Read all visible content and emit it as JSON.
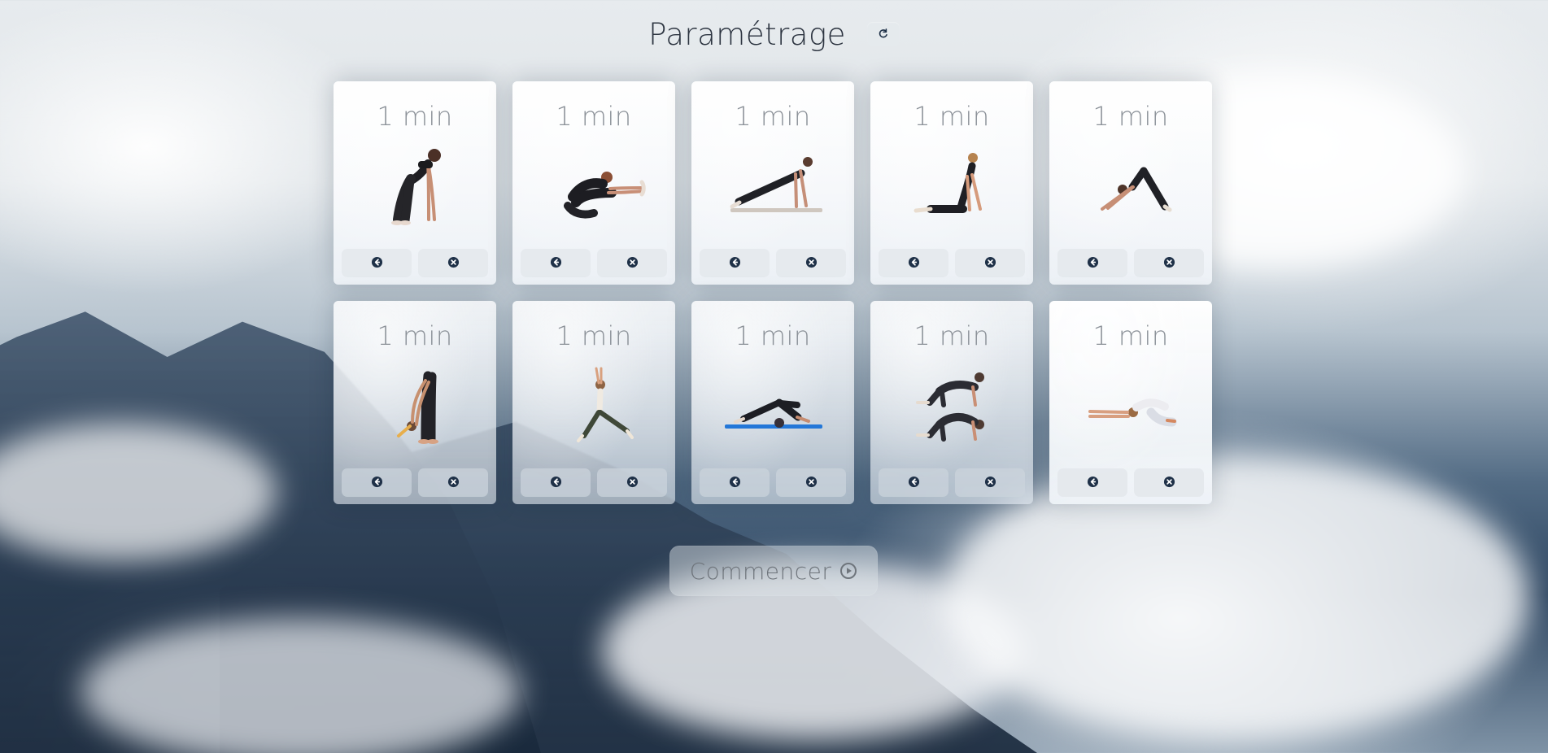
{
  "header": {
    "title": "Paramétrage",
    "reset_icon": "reset-icon"
  },
  "colors": {
    "text_dark": "#2c3440",
    "text_muted": "#8b9198",
    "icon_dark": "#1f3148",
    "button_bg": "#e5e9ed"
  },
  "cards": [
    {
      "time": "1 min",
      "pose": "forward-fold-pose",
      "back_icon": "arrow-left-icon",
      "remove_icon": "close-circle-icon"
    },
    {
      "time": "1 min",
      "pose": "seated-forward-bend-pose",
      "back_icon": "arrow-left-icon",
      "remove_icon": "close-circle-icon"
    },
    {
      "time": "1 min",
      "pose": "plank-pose",
      "back_icon": "arrow-left-icon",
      "remove_icon": "close-circle-icon"
    },
    {
      "time": "1 min",
      "pose": "cobra-pose",
      "back_icon": "arrow-left-icon",
      "remove_icon": "close-circle-icon"
    },
    {
      "time": "1 min",
      "pose": "downward-dog-pose",
      "back_icon": "arrow-left-icon",
      "remove_icon": "close-circle-icon"
    },
    {
      "time": "1 min",
      "pose": "standing-forward-bend-pose",
      "back_icon": "arrow-left-icon",
      "remove_icon": "close-circle-icon"
    },
    {
      "time": "1 min",
      "pose": "crescent-lunge-pose",
      "back_icon": "arrow-left-icon",
      "remove_icon": "close-circle-icon"
    },
    {
      "time": "1 min",
      "pose": "plow-pose",
      "back_icon": "arrow-left-icon",
      "remove_icon": "close-circle-icon"
    },
    {
      "time": "1 min",
      "pose": "cat-cow-pose",
      "back_icon": "arrow-left-icon",
      "remove_icon": "close-circle-icon"
    },
    {
      "time": "1 min",
      "pose": "child-pose",
      "back_icon": "arrow-left-icon",
      "remove_icon": "close-circle-icon"
    }
  ],
  "footer": {
    "start_label": "Commencer",
    "start_icon": "play-circle-icon"
  }
}
